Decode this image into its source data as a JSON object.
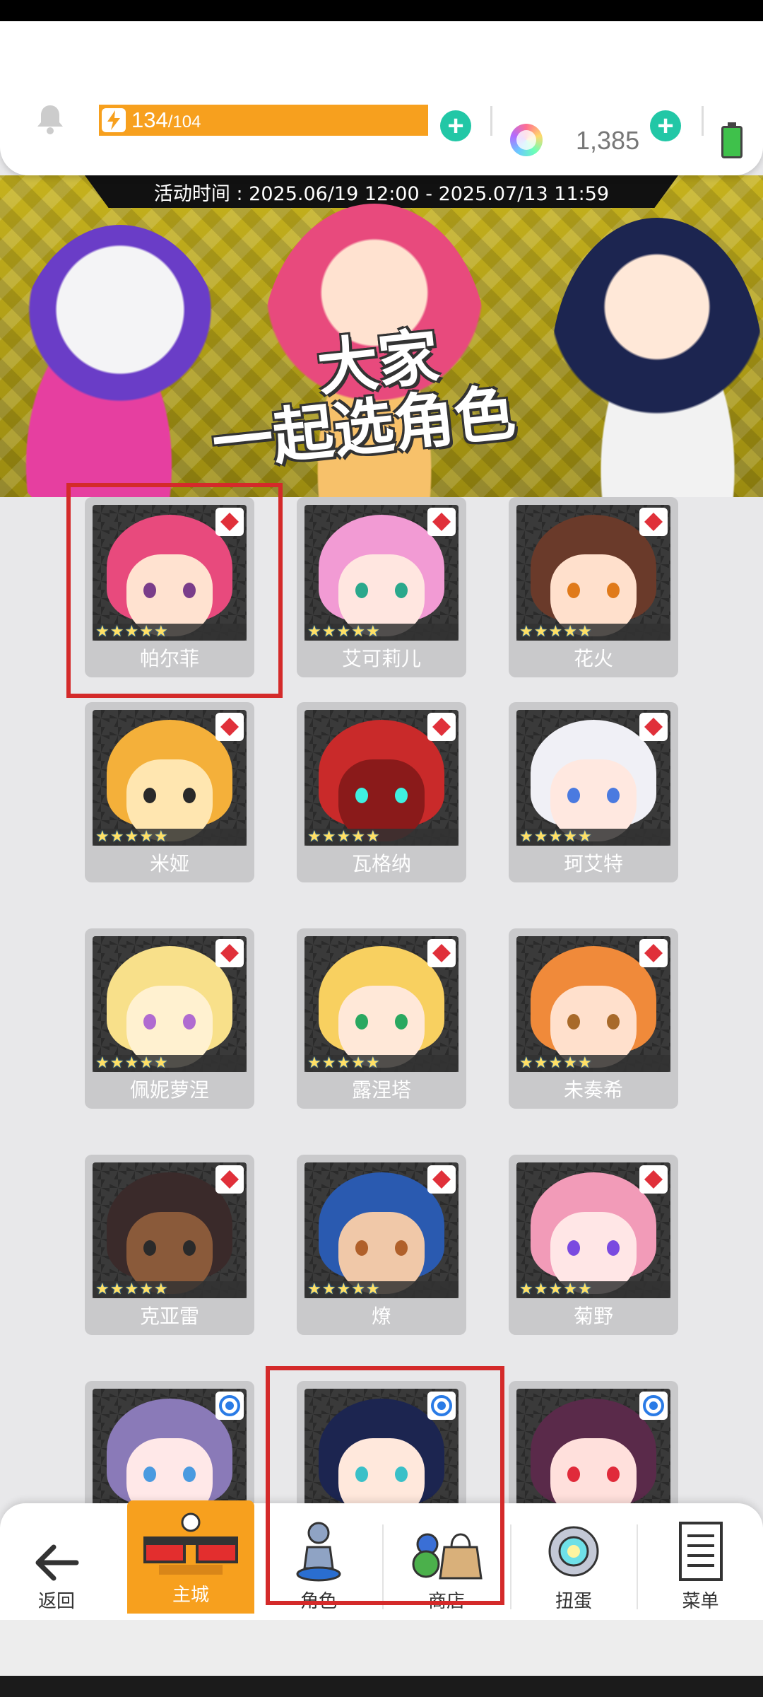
{
  "resources": {
    "stamina_current": "134",
    "stamina_max": "/104",
    "gems": "1,385"
  },
  "event": {
    "time_text": "活动时间 : 2025.06/19 12:00 - 2025.07/13 11:59",
    "banner_title_line1": "大家",
    "banner_title_line2": "一起选角色"
  },
  "characters": [
    {
      "name": "帕尔菲",
      "badge": "diamond-icon"
    },
    {
      "name": "艾可莉儿",
      "badge": "diamond-icon"
    },
    {
      "name": "花火",
      "badge": "diamond-icon"
    },
    {
      "name": "米娅",
      "badge": "diamond-icon"
    },
    {
      "name": "瓦格纳",
      "badge": "diamond-icon"
    },
    {
      "name": "珂艾特",
      "badge": "diamond-icon"
    },
    {
      "name": "佩妮萝涅",
      "badge": "diamond-icon"
    },
    {
      "name": "露涅塔",
      "badge": "diamond-icon"
    },
    {
      "name": "未奏希",
      "badge": "diamond-icon"
    },
    {
      "name": "克亚雷",
      "badge": "diamond-icon"
    },
    {
      "name": "燎",
      "badge": "diamond-icon"
    },
    {
      "name": "菊野",
      "badge": "diamond-icon"
    },
    {
      "name": "",
      "badge": "circle-icon"
    },
    {
      "name": "",
      "badge": "circle-icon"
    },
    {
      "name": "",
      "badge": "circle-icon"
    }
  ],
  "stars_glyph": "★★★★★",
  "nav": {
    "back": "返回",
    "main_city": "主城",
    "characters": "角色",
    "shop": "商店",
    "gacha": "扭蛋",
    "menu": "菜单"
  },
  "colors": {
    "accent_orange": "#f7a01e",
    "plus_green": "#22c7a6",
    "highlight_red": "#d42a2a",
    "badge_red": "#e0303a",
    "badge_blue": "#2a7be6"
  }
}
